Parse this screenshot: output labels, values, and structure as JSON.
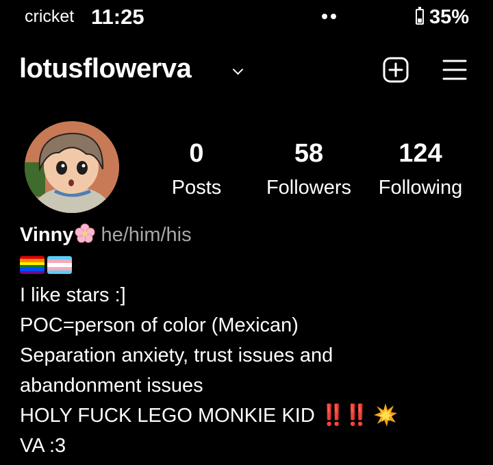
{
  "status_bar": {
    "carrier": "cricket",
    "time": "11:25",
    "battery": "35%",
    "battery_level": 0.35
  },
  "header": {
    "username": "lotusflowerva"
  },
  "stats": [
    {
      "value": "0",
      "label": "Posts"
    },
    {
      "value": "58",
      "label": "Followers"
    },
    {
      "value": "124",
      "label": "Following"
    }
  ],
  "bio": {
    "name": "Vinny",
    "pronouns": "he/him/his",
    "line1": "I like stars :]",
    "line2": "POC=person of color (Mexican)",
    "line3": "Separation anxiety, trust issues and",
    "line4": "abandonment issues",
    "line5": "HOLY FUCK LEGO MONKIE KID",
    "line5_marks": "‼️‼️",
    "line6": "VA :3"
  },
  "icons": [
    "cellular-dots-icon",
    "battery-icon",
    "chevron-down-icon",
    "new-post-icon",
    "menu-icon",
    "cherry-blossom-icon",
    "rainbow-flag-icon",
    "trans-flag-icon",
    "double-exclamation-icon",
    "collision-icon"
  ],
  "colors": {
    "background": "#000000",
    "text": "#ffffff",
    "secondary": "#a8a8a8",
    "accent_red": "#e22222"
  }
}
